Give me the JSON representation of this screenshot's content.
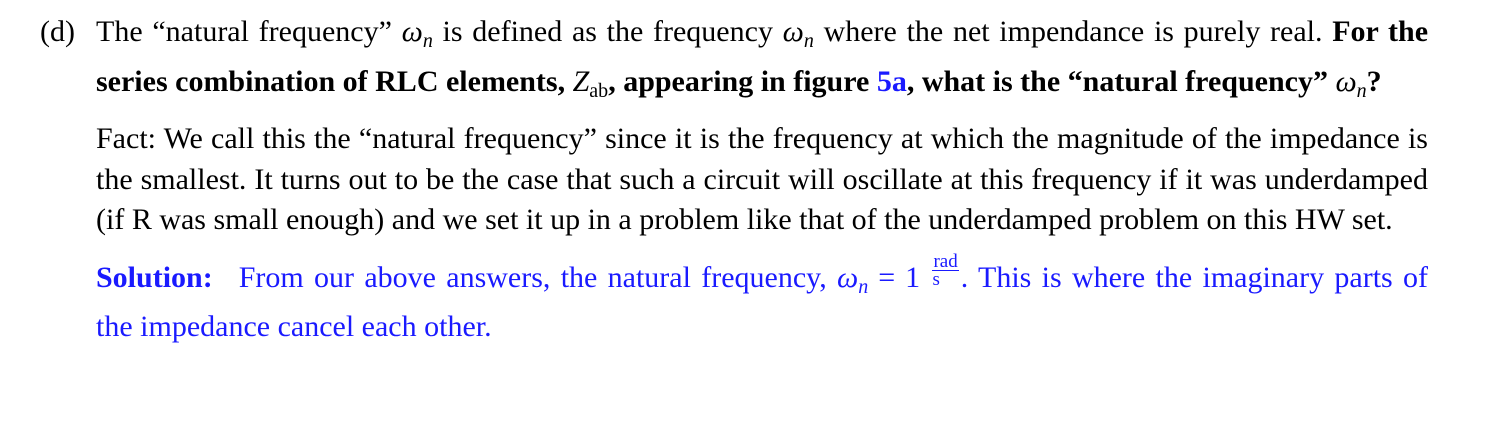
{
  "question": {
    "label": "(d)",
    "intro_before": "The “natural frequency”",
    "intro_mid": "is defined as the frequency",
    "intro_after": "where the net impendance is purely real.",
    "omega": "ω",
    "n_sub": "n",
    "bold_before": "For the series combination of RLC elements,",
    "Z": "Z",
    "Z_sub": "ab",
    "bold_mid": ", appearing in figure",
    "figure_ref": "5a",
    "bold_after": ", what is the “natural frequency”",
    "bold_end": "?"
  },
  "fact": {
    "text": "Fact: We call this the “natural frequency” since it is the frequency at which the magnitude of the impedance is the smallest. It turns out to be the case that such a circuit will oscillate at this frequency if it was underdamped (if R was small enough) and we set it up in a problem like that of the underdamped problem on this HW set."
  },
  "solution": {
    "label": "Solution:",
    "text_before": "From our above answers, the natural frequency,",
    "equals": "=",
    "value": "1",
    "unit_num": "rad",
    "unit_den": "s",
    "text_after": ". This is where the imaginary parts of the impedance cancel each other."
  },
  "colors": {
    "text": "#000000",
    "solution": "#1a1aff",
    "link": "#1a1aff"
  }
}
